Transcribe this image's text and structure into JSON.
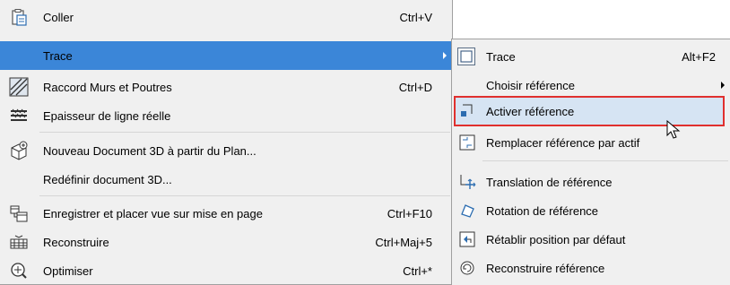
{
  "main_menu": {
    "items": [
      {
        "label": "Coller",
        "shortcut": "Ctrl+V",
        "icon": "paste-icon"
      },
      {
        "label": "Trace",
        "shortcut": "",
        "icon": "",
        "highlighted": true,
        "has_submenu": true
      },
      {
        "label": "Raccord Murs et Poutres",
        "shortcut": "Ctrl+D",
        "icon": "wall-beam-join-icon"
      },
      {
        "label": "Epaisseur de ligne réelle",
        "shortcut": "",
        "icon": "line-weight-icon"
      },
      {
        "label": "Nouveau Document 3D à partir du Plan...",
        "shortcut": "",
        "icon": "new-3d-document-icon"
      },
      {
        "label": "Redéfinir document 3D...",
        "shortcut": "",
        "icon": ""
      },
      {
        "label": "Enregistrer et placer vue sur mise en page",
        "shortcut": "Ctrl+F10",
        "icon": "save-place-view-icon"
      },
      {
        "label": "Reconstruire",
        "shortcut": "Ctrl+Maj+5",
        "icon": "rebuild-icon"
      },
      {
        "label": "Optimiser",
        "shortcut": "Ctrl+*",
        "icon": "optimize-icon"
      }
    ]
  },
  "sub_menu": {
    "items": [
      {
        "label": "Trace",
        "shortcut": "Alt+F2",
        "icon": "trace-icon"
      },
      {
        "label": "Choisir référence",
        "shortcut": "",
        "icon": "",
        "has_submenu": true
      },
      {
        "label": "Activer référence",
        "shortcut": "",
        "icon": "activate-reference-icon",
        "active": true
      },
      {
        "label": "Remplacer référence par actif",
        "shortcut": "",
        "icon": "replace-reference-icon"
      },
      {
        "label": "Translation de référence",
        "shortcut": "",
        "icon": "move-reference-icon"
      },
      {
        "label": "Rotation de référence",
        "shortcut": "",
        "icon": "rotate-reference-icon"
      },
      {
        "label": "Rétablir position par défaut",
        "shortcut": "",
        "icon": "reset-position-icon"
      },
      {
        "label": "Reconstruire référence",
        "shortcut": "",
        "icon": "rebuild-reference-icon"
      }
    ]
  },
  "colors": {
    "highlight": "#3b86d8",
    "active_outline": "#e0302e",
    "menu_bg": "#f0f0f0"
  }
}
